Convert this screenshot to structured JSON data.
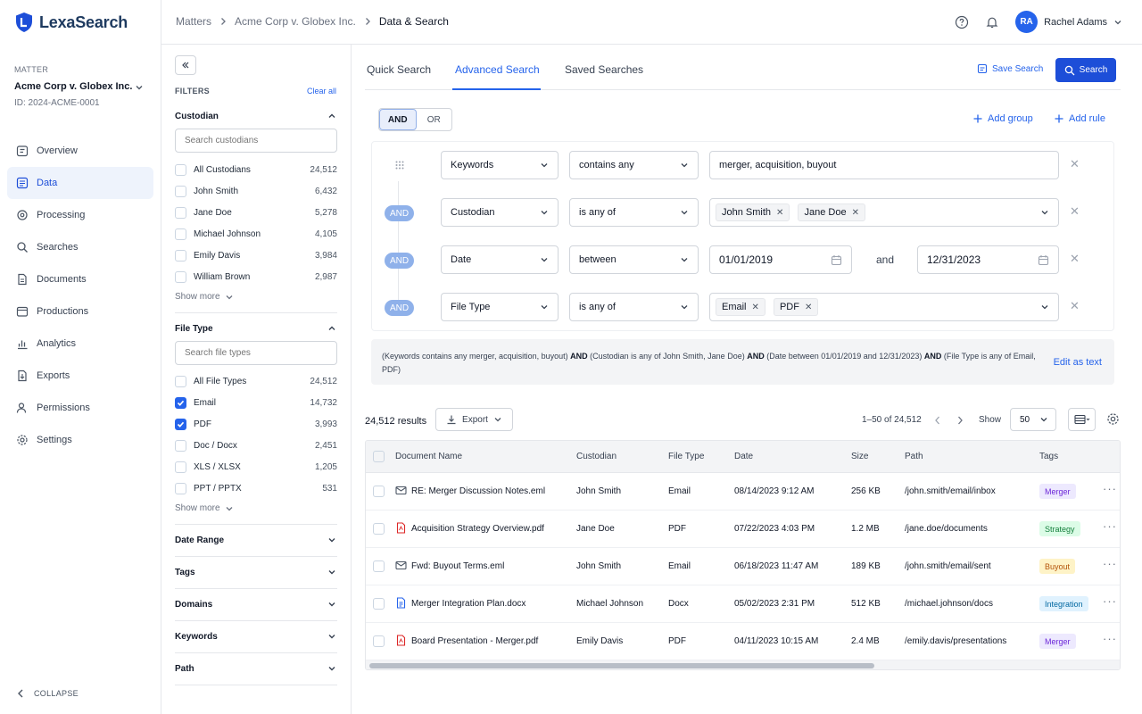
{
  "app": {
    "name": "LexaSearch"
  },
  "matter": {
    "label": "MATTER",
    "name": "Acme Corp v. Globex Inc.",
    "id": "ID: 2024-ACME-0001"
  },
  "nav": {
    "items": [
      {
        "label": "Overview",
        "icon": "calendar-icon"
      },
      {
        "label": "Data",
        "icon": "data-icon",
        "active": true
      },
      {
        "label": "Processing",
        "icon": "processing-icon"
      },
      {
        "label": "Searches",
        "icon": "search-icon"
      },
      {
        "label": "Documents",
        "icon": "document-icon"
      },
      {
        "label": "Productions",
        "icon": "productions-icon"
      },
      {
        "label": "Analytics",
        "icon": "analytics-icon"
      },
      {
        "label": "Exports",
        "icon": "export-icon"
      },
      {
        "label": "Permissions",
        "icon": "users-icon"
      },
      {
        "label": "Settings",
        "icon": "gear-icon"
      }
    ],
    "collapse": "COLLAPSE"
  },
  "breadcrumb": [
    "Matters",
    "Acme Corp v. Globex Inc.",
    "Data & Search"
  ],
  "user": {
    "initials": "RA",
    "name": "Rachel Adams"
  },
  "filters": {
    "title": "FILTERS",
    "clear": "Clear all",
    "custodian": {
      "title": "Custodian",
      "placeholder": "Search custodians",
      "items": [
        {
          "label": "All Custodians",
          "count": "24,512",
          "checked": false
        },
        {
          "label": "John Smith",
          "count": "6,432",
          "checked": false
        },
        {
          "label": "Jane Doe",
          "count": "5,278",
          "checked": false
        },
        {
          "label": "Michael Johnson",
          "count": "4,105",
          "checked": false
        },
        {
          "label": "Emily Davis",
          "count": "3,984",
          "checked": false
        },
        {
          "label": "William Brown",
          "count": "2,987",
          "checked": false
        }
      ],
      "show_more": "Show more"
    },
    "file_type": {
      "title": "File Type",
      "placeholder": "Search file types",
      "items": [
        {
          "label": "All File Types",
          "count": "24,512",
          "checked": false
        },
        {
          "label": "Email",
          "count": "14,732",
          "checked": true
        },
        {
          "label": "PDF",
          "count": "3,993",
          "checked": true
        },
        {
          "label": "Doc / Docx",
          "count": "2,451",
          "checked": false
        },
        {
          "label": "XLS / XLSX",
          "count": "1,205",
          "checked": false
        },
        {
          "label": "PPT / PPTX",
          "count": "531",
          "checked": false
        }
      ],
      "show_more": "Show more"
    },
    "collapsed_sections": [
      "Date Range",
      "Tags",
      "Domains",
      "Keywords",
      "Path"
    ]
  },
  "tabs": [
    "Quick Search",
    "Advanced Search",
    "Saved Searches"
  ],
  "actions": {
    "save_search": "Save Search",
    "search": "Search",
    "add_group": "Add group",
    "add_rule": "Add rule"
  },
  "logic": {
    "and": "AND",
    "or": "OR"
  },
  "rules": [
    {
      "connector": "",
      "field": "Keywords",
      "operator": "contains any",
      "value": "merger, acquisition, buyout"
    },
    {
      "connector": "AND",
      "field": "Custodian",
      "operator": "is any of",
      "chips": [
        "John Smith",
        "Jane Doe"
      ]
    },
    {
      "connector": "AND",
      "field": "Date",
      "operator": "between",
      "from": "01/01/2019",
      "and": "and",
      "to": "12/31/2023"
    },
    {
      "connector": "AND",
      "field": "File Type",
      "operator": "is any of",
      "chips": [
        "Email",
        "PDF"
      ]
    }
  ],
  "summary": {
    "parts": [
      {
        "t": "(Keywords contains any merger, acquisition, buyout) ",
        "b": false
      },
      {
        "t": "AND",
        "b": true
      },
      {
        "t": " (Custodian is any of John Smith, Jane Doe) ",
        "b": false
      },
      {
        "t": "AND",
        "b": true
      },
      {
        "t": " (Date between 01/01/2019 and 12/31/2023) ",
        "b": false
      },
      {
        "t": "AND",
        "b": true
      },
      {
        "t": " (File Type is any of Email, PDF)",
        "b": false
      }
    ],
    "edit": "Edit as text"
  },
  "results": {
    "count": "24,512 results",
    "export": "Export",
    "page_info": "1–50 of 24,512",
    "show_label": "Show",
    "page_size": "50",
    "columns": [
      "Document Name",
      "Custodian",
      "File Type",
      "Date",
      "Size",
      "Path",
      "Tags"
    ],
    "rows": [
      {
        "icon": "email-icon",
        "name": "RE: Merger Discussion Notes.eml",
        "custodian": "John Smith",
        "type": "Email",
        "date": "08/14/2023 9:12 AM",
        "size": "256 KB",
        "path": "/john.smith/email/inbox",
        "tag": "Merger",
        "tag_bg": "#ede9fe",
        "tag_fg": "#6d28d9"
      },
      {
        "icon": "pdf-icon",
        "name": "Acquisition Strategy Overview.pdf",
        "custodian": "Jane Doe",
        "type": "PDF",
        "date": "07/22/2023 4:03 PM",
        "size": "1.2 MB",
        "path": "/jane.doe/documents",
        "tag": "Strategy",
        "tag_bg": "#dcfce7",
        "tag_fg": "#15803d"
      },
      {
        "icon": "email-icon",
        "name": "Fwd: Buyout Terms.eml",
        "custodian": "John Smith",
        "type": "Email",
        "date": "06/18/2023 11:47 AM",
        "size": "189 KB",
        "path": "/john.smith/email/sent",
        "tag": "Buyout",
        "tag_bg": "#fef3c7",
        "tag_fg": "#b45309"
      },
      {
        "icon": "docx-icon",
        "name": "Merger Integration Plan.docx",
        "custodian": "Michael Johnson",
        "type": "Docx",
        "date": "05/02/2023 2:31 PM",
        "size": "512 KB",
        "path": "/michael.johnson/docs",
        "tag": "Integration",
        "tag_bg": "#e0f2fe",
        "tag_fg": "#0369a1"
      },
      {
        "icon": "pdf-icon",
        "name": "Board Presentation - Merger.pdf",
        "custodian": "Emily Davis",
        "type": "PDF",
        "date": "04/11/2023 10:15 AM",
        "size": "2.4 MB",
        "path": "/emily.davis/presentations",
        "tag": "Merger",
        "tag_bg": "#ede9fe",
        "tag_fg": "#6d28d9"
      }
    ]
  },
  "colors": {
    "accent": "#2563eb",
    "brand": "#1e3a5f",
    "pill": "#8fb1ea"
  }
}
